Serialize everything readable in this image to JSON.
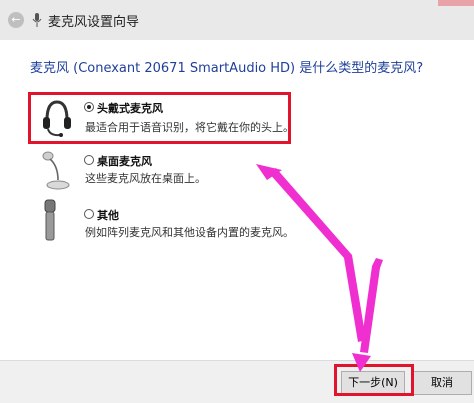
{
  "window": {
    "title": "麦克风设置向导",
    "back_icon": "back-arrow-icon",
    "title_icon": "microphone-icon"
  },
  "question": "麦克风 (Conexant 20671 SmartAudio HD) 是什么类型的麦克风?",
  "options": [
    {
      "label": "头戴式麦克风",
      "description": "最适合用于语音识别，将它戴在你的头上。",
      "icon": "headset-icon",
      "selected": true
    },
    {
      "label": "桌面麦克风",
      "description": "这些麦克风放在桌面上。",
      "icon": "desktop-microphone-icon",
      "selected": false
    },
    {
      "label": "其他",
      "description": "例如阵列麦克风和其他设备内置的麦克风。",
      "icon": "handheld-microphone-icon",
      "selected": false
    }
  ],
  "buttons": {
    "next": "下一步(N)",
    "cancel": "取消"
  },
  "annotation_colors": {
    "highlight_box": "#e0142d",
    "arrow": "#f02fd0"
  }
}
